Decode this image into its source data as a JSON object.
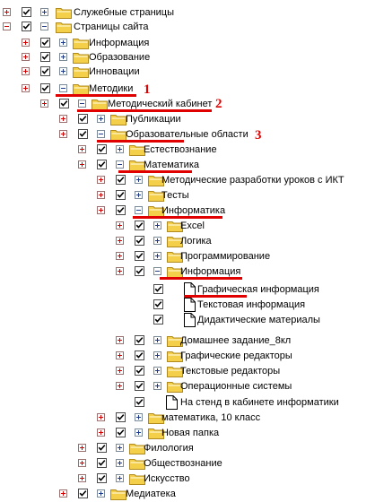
{
  "tree": [
    {
      "expander": "plus-red",
      "label": "Служебные страницы",
      "icon": "folder-icon"
    },
    {
      "expander": "minus-red",
      "label": "Страницы сайта",
      "icon": "folder-icon"
    },
    {
      "expander": "plus-red",
      "label": "Информация",
      "icon": "folder-icon"
    },
    {
      "expander": "plus-red",
      "label": "Образование",
      "icon": "folder-icon"
    },
    {
      "expander": "plus-red",
      "label": "Инновации",
      "icon": "folder-icon"
    },
    {
      "expander": "plus-red",
      "label": "Методики",
      "icon": "folder-icon"
    },
    {
      "expander": "plus-red",
      "label": "Методический кабинет",
      "icon": "folder-icon"
    },
    {
      "expander": "plus-red",
      "label": "Публикации",
      "icon": "folder-icon"
    },
    {
      "expander": "plus-red",
      "label": "Образовательные области",
      "icon": "folder-icon"
    },
    {
      "expander": "plus-red",
      "label": "Естествознание",
      "icon": "folder-icon"
    },
    {
      "expander": "plus-red",
      "label": "Математика",
      "icon": "folder-icon"
    },
    {
      "expander": "plus-red",
      "label": "Методические разработки уроков с ИКТ",
      "icon": "folder-icon"
    },
    {
      "expander": "plus-red",
      "label": "Тесты",
      "icon": "folder-icon"
    },
    {
      "expander": "plus-red",
      "label": "Информатика",
      "icon": "folder-icon"
    },
    {
      "expander": "plus-red",
      "label": "Excel",
      "icon": "folder-icon"
    },
    {
      "expander": "plus-red",
      "label": "Логика",
      "icon": "folder-icon"
    },
    {
      "expander": "plus-red",
      "label": "Программирование",
      "icon": "folder-icon"
    },
    {
      "expander": "plus-red",
      "label": "Информация",
      "icon": "folder-icon"
    },
    {
      "expander": "none",
      "label": "Графическая информация",
      "icon": "page-icon"
    },
    {
      "expander": "none",
      "label": "Текстовая информация",
      "icon": "page-icon"
    },
    {
      "expander": "none",
      "label": "Дидактические материалы",
      "icon": "page-icon"
    },
    {
      "expander": "plus-red",
      "label": "Домашнее задание_8кл",
      "icon": "folder-icon"
    },
    {
      "expander": "plus-red",
      "label": "Графические редакторы",
      "icon": "folder-icon"
    },
    {
      "expander": "plus-red",
      "label": "Текстовые редакторы",
      "icon": "folder-icon"
    },
    {
      "expander": "plus-red",
      "label": "Операционные системы",
      "icon": "folder-icon"
    },
    {
      "expander": "none",
      "label": "На стенд в кабинете информатики",
      "icon": "page-icon"
    },
    {
      "expander": "plus-red",
      "label": "математика, 10 класс",
      "icon": "folder-icon"
    },
    {
      "expander": "plus-red",
      "label": "Новая папка",
      "icon": "folder-icon"
    },
    {
      "expander": "plus-red",
      "label": "Филология",
      "icon": "folder-icon"
    },
    {
      "expander": "plus-red",
      "label": "Обществознание",
      "icon": "folder-icon"
    },
    {
      "expander": "plus-red",
      "label": "Искусство",
      "icon": "folder-icon"
    },
    {
      "expander": "plus-red",
      "label": "Медиатека",
      "icon": "folder-icon"
    }
  ],
  "annotations": [
    {
      "number": "1",
      "color": "#e10000"
    },
    {
      "number": "2",
      "color": "#e10000"
    },
    {
      "number": "3",
      "color": "#e10000"
    }
  ],
  "colors": {
    "annotation": "#e10000",
    "expander_plus": "#d40000",
    "folder": "#f3cf4a"
  }
}
